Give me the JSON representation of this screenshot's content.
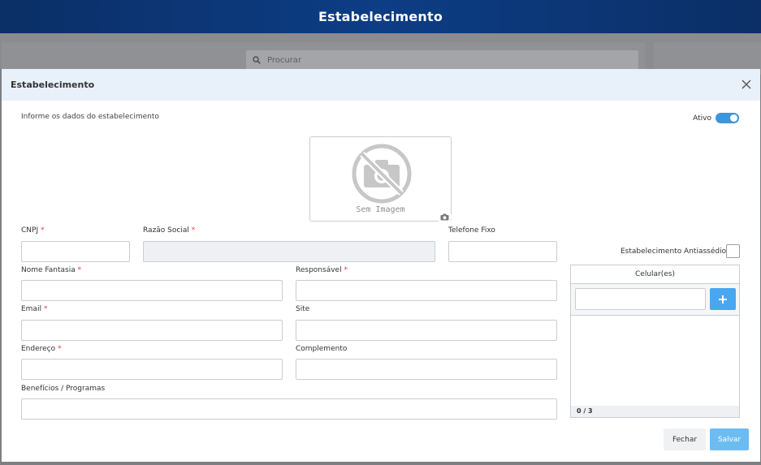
{
  "app": {
    "title": "Estabelecimento"
  },
  "background": {
    "search_placeholder": "Procurar"
  },
  "modal": {
    "title": "Estabelecimento",
    "subtitle": "Informe os dados do estabelecimento",
    "active_label": "Ativo",
    "active": true,
    "image_placeholder": "Sem Imagem",
    "required_marker": "*",
    "fields": {
      "cnpj": {
        "label": "CNPJ",
        "value": ""
      },
      "razao_social": {
        "label": "Razão Social",
        "value": ""
      },
      "telefone_fixo": {
        "label": "Telefone Fixo",
        "value": ""
      },
      "nome_fantasia": {
        "label": "Nome Fantasia",
        "value": ""
      },
      "responsavel": {
        "label": "Responsável",
        "value": ""
      },
      "email": {
        "label": "Email",
        "value": ""
      },
      "site": {
        "label": "Site",
        "value": ""
      },
      "endereco": {
        "label": "Endereço",
        "value": ""
      },
      "complemento": {
        "label": "Complemento",
        "value": ""
      },
      "beneficios": {
        "label": "Benefícios / Programas",
        "value": ""
      }
    },
    "antiassedio_label": "Estabelecimento Antiassédio?",
    "antiassedio_checked": false,
    "celulares": {
      "header": "Celular(es)",
      "counter": "0 / 3",
      "input_value": ""
    },
    "buttons": {
      "close": "Fechar",
      "save": "Salvar"
    }
  },
  "colors": {
    "header": "#0b2f66",
    "accent": "#3d95dc",
    "save": "#6cbcf2",
    "required": "#e03c3c"
  },
  "icons": [
    "search-icon",
    "close-icon",
    "no-image-icon",
    "camera-icon",
    "plus-icon"
  ]
}
